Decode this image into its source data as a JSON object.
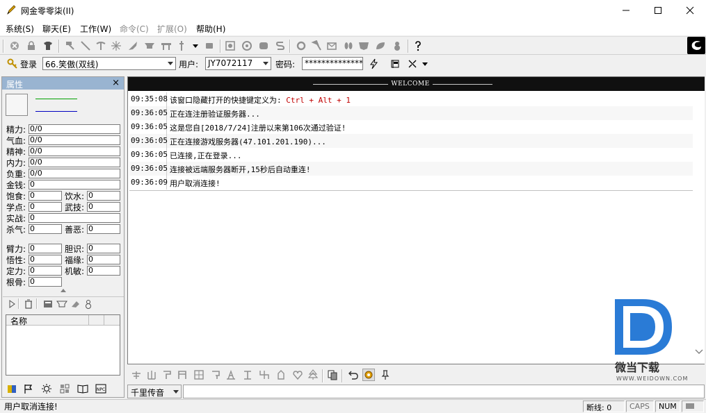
{
  "window": {
    "title": "网金零零柒(II)"
  },
  "menu": [
    {
      "label": "系统(S)",
      "enabled": true
    },
    {
      "label": "聊天(E)",
      "enabled": true
    },
    {
      "label": "工作(W)",
      "enabled": true
    },
    {
      "label": "命令(C)",
      "enabled": false
    },
    {
      "label": "扩展(O)",
      "enabled": false
    },
    {
      "label": "帮助(H)",
      "enabled": true
    }
  ],
  "login": {
    "login_label": "登录",
    "server": "66.笑傲(双线)",
    "user_label": "用户:",
    "user": "JY7072117",
    "password_label": "密码:",
    "password": "**************"
  },
  "panel": {
    "title": "属性",
    "close": "×",
    "stats": [
      {
        "label": "精力:",
        "value": "0/0"
      },
      {
        "label": "气血:",
        "value": "0/0"
      },
      {
        "label": "精神:",
        "value": "0/0"
      },
      {
        "label": "内力:",
        "value": "0/0"
      },
      {
        "label": "负重:",
        "value": "0/0"
      },
      {
        "label": "金钱:",
        "value": "0"
      }
    ],
    "pairs": [
      {
        "l1": "饱食:",
        "v1": "0",
        "l2": "饮水:",
        "v2": "0"
      },
      {
        "l1": "学点:",
        "v1": "0",
        "l2": "武技:",
        "v2": "0"
      }
    ],
    "shizhan": {
      "label": "实战:",
      "value": "0"
    },
    "shaqi": {
      "l1": "杀气:",
      "v1": "0",
      "l2": "善恶:",
      "v2": "0"
    },
    "pairs2": [
      {
        "l1": "臂力:",
        "v1": "0",
        "l2": "胆识:",
        "v2": "0"
      },
      {
        "l1": "悟性:",
        "v1": "0",
        "l2": "福缘:",
        "v2": "0"
      },
      {
        "l1": "定力:",
        "v1": "0",
        "l2": "机敏:",
        "v2": "0"
      }
    ],
    "gengu": {
      "label": "根骨:",
      "value": "0"
    },
    "list_header": "名称"
  },
  "chat": {
    "banner": "WELCOME",
    "messages": [
      {
        "time": "09:35:08",
        "text": "该窗口隐藏打开的快捷键定义为:",
        "hot": "Ctrl + Alt + 1"
      },
      {
        "time": "09:36:05",
        "text": "正在连注册验证服务器...",
        "hot": ""
      },
      {
        "time": "09:36:05",
        "text": "这是您自[2018/7/24]注册以来第106次通过验证!",
        "hot": ""
      },
      {
        "time": "09:36:05",
        "text": "正在连接游戏服务器(47.101.201.190)...",
        "hot": ""
      },
      {
        "time": "09:36:05",
        "text": "已连接,正在登录...",
        "hot": ""
      },
      {
        "time": "09:36:05",
        "text": "连接被远端服务器断开,15秒后自动重连!",
        "hot": ""
      },
      {
        "time": "09:36:09",
        "text": "用户取消连接!",
        "hot": ""
      }
    ]
  },
  "watermark": {
    "brand": "微当下载",
    "url": "WWW.WEIDOWN.COM"
  },
  "input": {
    "channel": "千里传音",
    "value": ""
  },
  "status": {
    "message": "用户取消连接!",
    "disconnect": "断线: 0",
    "caps": "CAPS",
    "num": "NUM"
  }
}
